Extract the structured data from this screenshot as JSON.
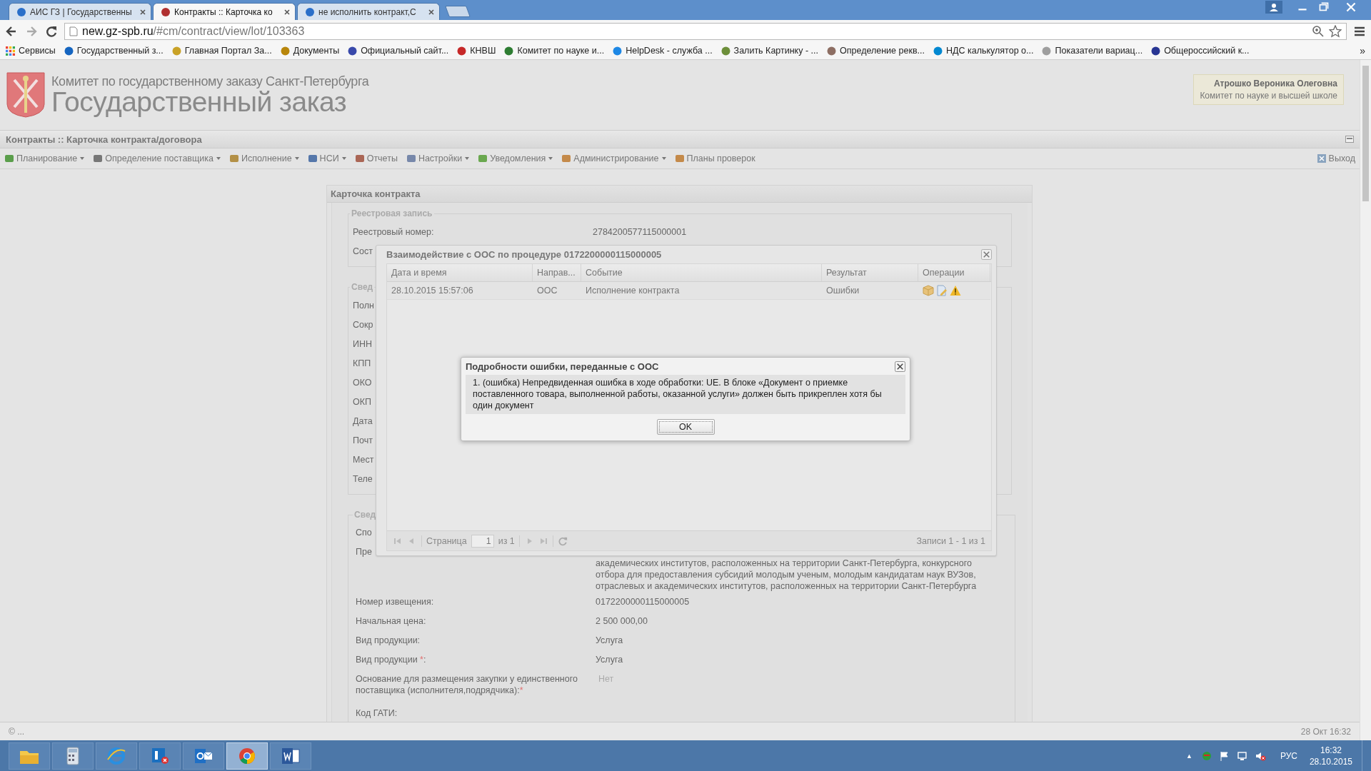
{
  "browser": {
    "tabs": [
      {
        "title": "АИС ГЗ | Государственны",
        "selected": false
      },
      {
        "title": "Контракты :: Карточка ко",
        "selected": true
      },
      {
        "title": "не исполнить контракт,С",
        "selected": false
      }
    ],
    "address": {
      "host": "new.gz-spb.ru",
      "path": "/#cm/contract/view/lot/103363"
    },
    "bookmarks": [
      "Сервисы",
      "Государственный з...",
      "Главная Портал За...",
      "Документы",
      "Официальный сайт...",
      "КНВШ",
      "Комитет по науке и...",
      "HelpDesk - служба ...",
      "Залить Картинку - ...",
      "Определение рекв...",
      "НДС калькулятор о...",
      "Показатели вариац...",
      "Общероссийский к..."
    ],
    "bookmarks_more": "»"
  },
  "header": {
    "org": "Комитет по государственному заказу Санкт-Петербурга",
    "title": "Государственный заказ",
    "user": {
      "name": "Атрошко Вероника Олеговна",
      "department": "Комитет по науке и высшей школе"
    }
  },
  "breadcrumb": "Контракты :: Карточка контракта/договора",
  "menu": [
    {
      "label": "Планирование",
      "dropdown": true
    },
    {
      "label": "Определение поставщика",
      "dropdown": true
    },
    {
      "label": "Исполнение",
      "dropdown": true
    },
    {
      "label": "НСИ",
      "dropdown": true
    },
    {
      "label": "Отчеты",
      "dropdown": false
    },
    {
      "label": "Настройки",
      "dropdown": true
    },
    {
      "label": "Уведомления",
      "dropdown": true
    },
    {
      "label": "Администрирование",
      "dropdown": true
    },
    {
      "label": "Планы проверок",
      "dropdown": false
    }
  ],
  "logout": "Выход",
  "card": {
    "title": "Карточка контракта",
    "sections": [
      {
        "legend": "Реестровая запись",
        "rows": [
          {
            "label": "Реестровый номер:",
            "value": "2784200577115000001"
          },
          {
            "label": "Сост"
          }
        ]
      },
      {
        "legend": "Свед",
        "rows": [
          {
            "label": "Полн"
          },
          {
            "label": "Сокр"
          },
          {
            "label": "ИНН"
          },
          {
            "label": "КПП"
          },
          {
            "label": "ОКО"
          },
          {
            "label": "ОКП"
          },
          {
            "label": "Дата"
          },
          {
            "label": "Почт"
          },
          {
            "label": "Мест"
          },
          {
            "label": "Теле"
          }
        ]
      },
      {
        "legend": "Свед",
        "rows": [
          {
            "label": "Спо"
          },
          {
            "label": "Пре",
            "value": "академических институтов, расположенных на территории Санкт-Петербурга, конкурсного\nотбора для предоставления субсидий молодым ученым, молодым кандидатам наук ВУЗов,\nотраслевых и академических институтов, расположенных на территории Санкт-Петербурга",
            "covered_first_line": true
          },
          {
            "label": "Номер извещения:",
            "value": "0172200000115000005"
          },
          {
            "label": "Начальная цена:",
            "value": "2 500 000,00"
          },
          {
            "label": "Вид продукции:",
            "value": "Услуга"
          },
          {
            "label": "Вид продукции ",
            "required_mark": "*",
            "label_end": ":",
            "value": "Услуга"
          },
          {
            "label": "Основание для размещения закупки у единственного поставщика (исполнителя,подрядчика):",
            "required_mark": "*",
            "placeholder": "Нет"
          },
          {
            "label": "Код ГАТИ:"
          }
        ]
      }
    ]
  },
  "interaction_dialog": {
    "title": "Взаимодействие с ООС по процедуре 0172200000115000005",
    "columns": [
      "Дата и время",
      "Направ...",
      "Событие",
      "Результат",
      "Операции"
    ],
    "rows": [
      {
        "date": "28.10.2015 15:57:06",
        "direction": "ООС",
        "event": "Исполнение контракта",
        "result": "Ошибки"
      }
    ],
    "pager": {
      "page_label": "Страница",
      "page": "1",
      "of": "из 1",
      "records": "Записи 1 - 1 из 1"
    }
  },
  "error_dialog": {
    "title": "Подробности ошибки, переданные с ООС",
    "message": "1. (ошибка) Непредвиденная ошибка в ходе обработки: UE. В блоке «Документ о приемке поставленного товара, выполненной работы, оказанной услуги» должен быть прикреплен хотя бы один документ",
    "button": "OK"
  },
  "status_bar": {
    "left": "© ...",
    "right": "28 Окт 16:32"
  },
  "taskbar": {
    "apps": [
      {
        "kind": "folder",
        "selected": false
      },
      {
        "kind": "calculator",
        "selected": false
      },
      {
        "kind": "browser",
        "selected": false
      },
      {
        "kind": "messenger",
        "selected": false
      },
      {
        "kind": "mail",
        "selected": false
      },
      {
        "kind": "chrome",
        "selected": true
      },
      {
        "kind": "word",
        "selected": false
      }
    ],
    "tray_caret": "▲",
    "language": "РУС",
    "time": "16:32",
    "date": "28.10.2015"
  }
}
